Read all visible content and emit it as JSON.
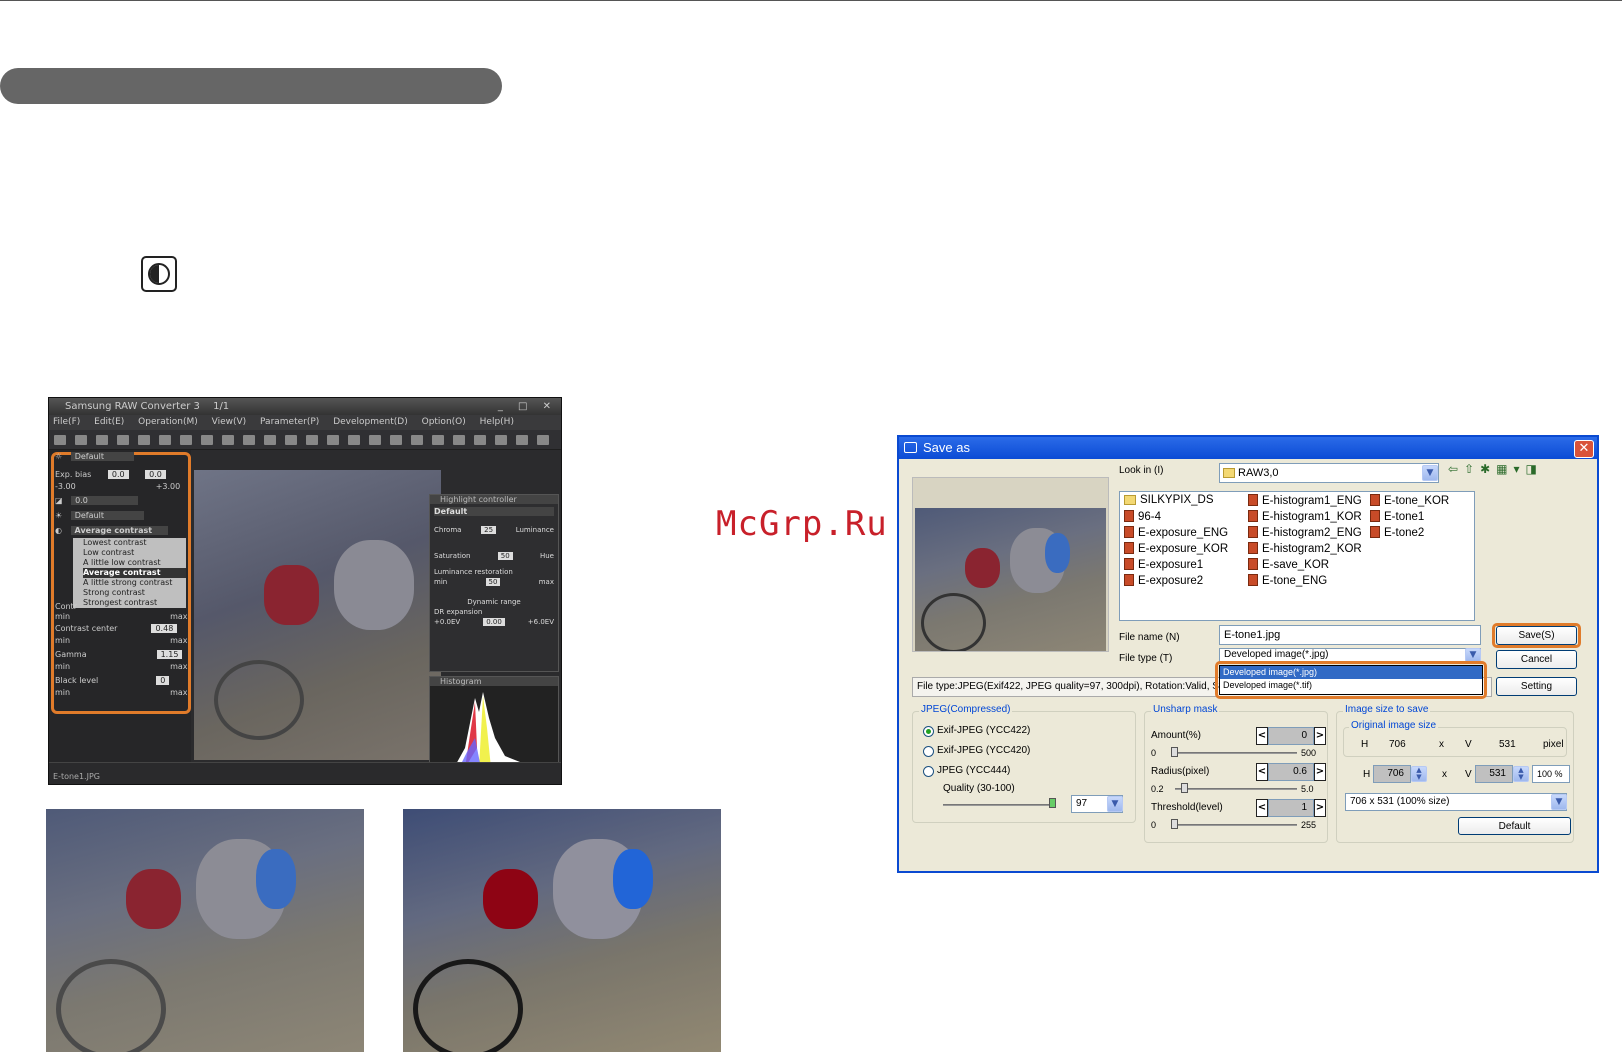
{
  "watermark": "McGrp.Ru",
  "src_window": {
    "title": "Samsung RAW Converter 3",
    "title_counter": "1/1",
    "menu": [
      "File(F)",
      "Edit(E)",
      "Operation(M)",
      "View(V)",
      "Parameter(P)",
      "Development(D)",
      "Option(O)",
      "Help(H)"
    ],
    "preset_label": "Default",
    "exp_bias_label": "Exp. bias",
    "exp_bias_value": "0.0",
    "exp_bias_value2": "0.0",
    "exp_min": "-3.00",
    "exp_max": "+3.00",
    "wb_value": "0.0",
    "wb_preset": "Default",
    "tone_selected": "Average contrast",
    "tone_options": [
      "Lowest contrast",
      "Low contrast",
      "A little low contrast",
      "Average contrast",
      "A little strong contrast",
      "Strong contrast",
      "Strongest contrast"
    ],
    "contrast_label": "Contr",
    "contrast_center_label": "Contrast center",
    "contrast_center_value": "0.48",
    "gamma_label": "Gamma",
    "gamma_value": "1.15",
    "black_level_label": "Black level",
    "black_level_value": "0",
    "min_label": "min",
    "max_label": "max",
    "highlight_title": "Highlight controller",
    "hc_preset": "Default",
    "chroma_label": "Chroma",
    "luminance_label": "Luminance",
    "hc_value1": "25",
    "saturation_label": "Saturation",
    "hue_label": "Hue",
    "hc_value2": "50",
    "lum_restoration_label": "Luminance restoration",
    "hc_value3": "50",
    "dynamic_range_label": "Dynamic range",
    "dr_expansion_label": "DR expansion",
    "dr_min": "+0.0EV",
    "dr_value": "0.00",
    "dr_max": "+6.0EV",
    "histogram_title": "Histogram",
    "status_file": "E-tone1.JPG"
  },
  "dialog": {
    "title": "Save as",
    "look_in_label": "Look in (I)",
    "look_in_value": "RAW3,0",
    "files_col1": [
      "SILKYPIX_DS",
      "96-4",
      "E-exposure_ENG",
      "E-exposure_KOR",
      "E-exposure1",
      "E-exposure2"
    ],
    "files_col2": [
      "E-histogram1_ENG",
      "E-histogram1_KOR",
      "E-histogram2_ENG",
      "E-histogram2_KOR",
      "E-save_KOR",
      "E-tone_ENG"
    ],
    "files_col3": [
      "E-tone_KOR",
      "E-tone1",
      "E-tone2"
    ],
    "file_name_label": "File name (N)",
    "file_name_value": "E-tone1.jpg",
    "file_type_label": "File type (T)",
    "file_type_value": "Developed image(*.jpg)",
    "file_type_options": [
      "Developed image(*.jpg)",
      "Developed image(*.tif)"
    ],
    "save_label": "Save(S)",
    "cancel_label": "Cancel",
    "setting_label": "Setting",
    "info_text": "File type:JPEG(Exif422, JPEG quality=97, 300dpi), Rotation:Valid, S",
    "jpeg_group": "JPEG(Compressed)",
    "jpeg_opt1": "Exif-JPEG  (YCC422)",
    "jpeg_opt2": "Exif-JPEG  (YCC420)",
    "jpeg_opt3": "JPEG  (YCC444)",
    "quality_label": "Quality (30-100)",
    "quality_value": "97",
    "unsharp_group": "Unsharp mask",
    "amount_label": "Amount(%)",
    "amount_value": "0",
    "amount_min": "0",
    "amount_max": "500",
    "radius_label": "Radius(pixel)",
    "radius_value": "0.6",
    "radius_min": "0.2",
    "radius_max": "5.0",
    "threshold_label": "Threshold(level)",
    "threshold_value": "1",
    "threshold_min": "0",
    "threshold_max": "255",
    "size_group": "Image size to save",
    "orig_size_group": "Original image size",
    "h_label": "H",
    "h_orig": "706",
    "x_label": "x",
    "v_label": "V",
    "v_orig": "531",
    "pixel_label": "pixel",
    "h_value": "706",
    "v_value": "531",
    "percent_value": "100 %",
    "size_select": "706 x  531  (100% size)",
    "default_label": "Default"
  },
  "colors": {
    "accent_orange": "#e07b2a",
    "xp_blue": "#0a4ad1",
    "watermark_red": "#c8202a"
  }
}
